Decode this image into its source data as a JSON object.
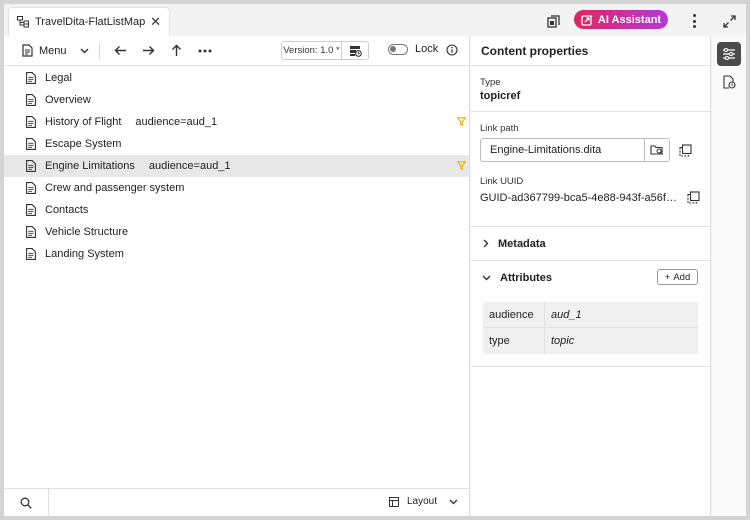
{
  "tab": {
    "title": "TravelDita-FlatListMap",
    "close": "✕"
  },
  "topbar": {
    "ai_label": "AI Assistant"
  },
  "toolbar": {
    "menu_label": "Menu",
    "version_label": "Version: 1.0 *",
    "lock_label": "Lock"
  },
  "tree": {
    "items": [
      {
        "label": "Legal",
        "condition": ""
      },
      {
        "label": "Overview",
        "condition": ""
      },
      {
        "label": "History of Flight",
        "condition": "audience=aud_1"
      },
      {
        "label": "Escape System",
        "condition": ""
      },
      {
        "label": "Engine Limitations",
        "condition": "audience=aud_1"
      },
      {
        "label": "Crew and passenger system",
        "condition": ""
      },
      {
        "label": "Contacts",
        "condition": ""
      },
      {
        "label": "Vehicle Structure",
        "condition": ""
      },
      {
        "label": "Landing System",
        "condition": ""
      }
    ],
    "selected": "Engine Limitations"
  },
  "bottombar": {
    "layout_label": "Layout"
  },
  "properties": {
    "header": "Content properties",
    "type_label": "Type",
    "type_value": "topicref",
    "link_path_label": "Link path",
    "link_path_value": "Engine-Limitations.dita",
    "link_uuid_label": "Link UUID",
    "link_uuid_value": "GUID-ad367799-bca5-4e88-943f-a56fafb6...",
    "metadata_label": "Metadata",
    "attributes_label": "Attributes",
    "add_label": "Add",
    "attributes": [
      {
        "key": "audience",
        "value": "aud_1"
      },
      {
        "key": "type",
        "value": "topic"
      }
    ]
  },
  "colors": {
    "ai_gradient_start": "#e0245e",
    "ai_gradient_end": "#b43ad8",
    "selected_row": "#e8e8e8",
    "filter_icon": "#e0b000"
  }
}
